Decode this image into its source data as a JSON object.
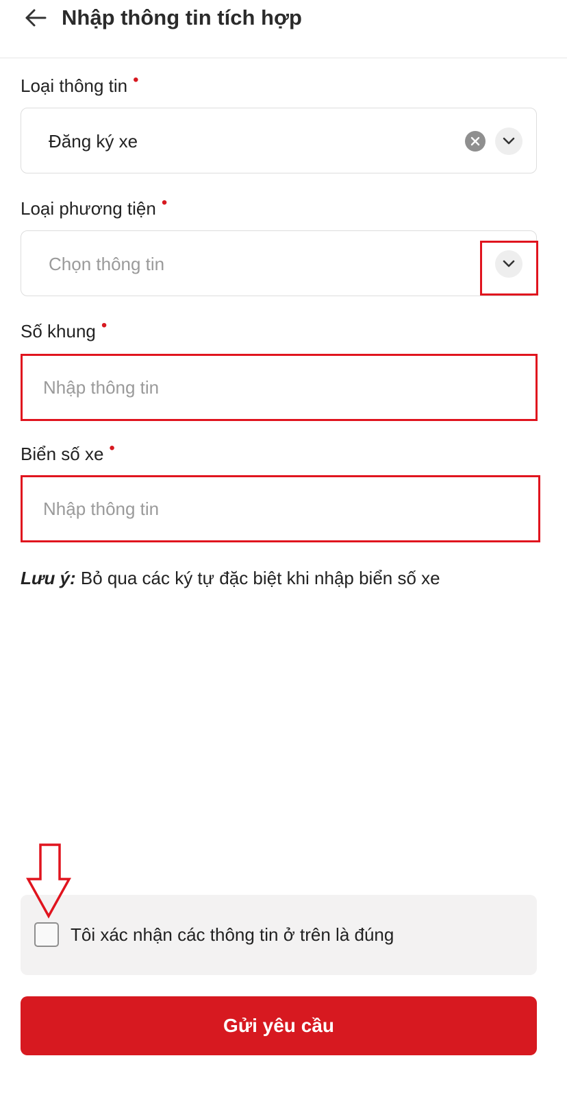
{
  "header": {
    "title": "Nhập thông tin tích hợp"
  },
  "fields": {
    "info_type": {
      "label": "Loại thông tin",
      "value": "Đăng ký xe"
    },
    "vehicle_type": {
      "label": "Loại phương tiện",
      "placeholder": "Chọn thông tin"
    },
    "frame_number": {
      "label": "Số khung",
      "placeholder": "Nhập thông tin",
      "value": ""
    },
    "license_plate": {
      "label": "Biển số xe",
      "placeholder": "Nhập thông tin",
      "value": ""
    },
    "required_marker": "•"
  },
  "note": {
    "prefix": "Lưu ý:",
    "text": " Bỏ qua các ký tự đặc biệt khi nhập biển số xe"
  },
  "confirm": {
    "label": "Tôi xác nhận các thông tin ở trên là đúng",
    "checked": false
  },
  "submit": {
    "label": "Gửi yêu cầu"
  },
  "colors": {
    "accent": "#d71920",
    "annotation": "#e0141e"
  },
  "icons": {
    "back": "arrow-left-icon",
    "clear": "close-circle-icon",
    "dropdown": "chevron-down-icon",
    "annotation": "down-arrow-icon"
  }
}
